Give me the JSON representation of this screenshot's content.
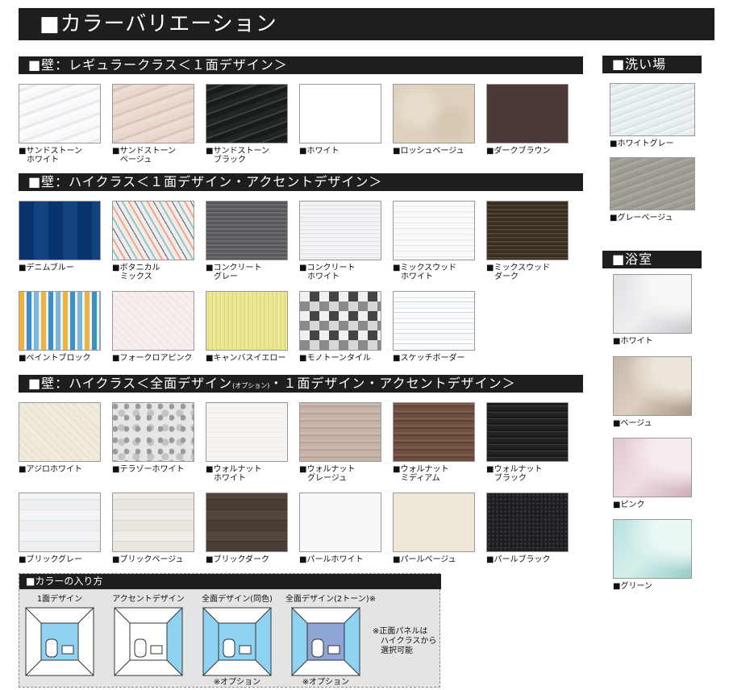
{
  "title": "■カラーバリエーション",
  "wall_regular": {
    "heading": "■壁：レギュラークラス＜１面デザイン＞",
    "items": [
      {
        "l1": "■サンドストーン",
        "l2": "ホワイト"
      },
      {
        "l1": "■サンドストーン",
        "l2": "ベージュ"
      },
      {
        "l1": "■サンドストーン",
        "l2": "ブラック"
      },
      {
        "l1": "■ホワイト",
        "l2": ""
      },
      {
        "l1": "■ロッシュベージュ",
        "l2": ""
      },
      {
        "l1": "■ダークブラウン",
        "l2": ""
      }
    ]
  },
  "wall_high1": {
    "heading": "■壁：ハイクラス＜１面デザイン・アクセントデザイン＞",
    "items": [
      {
        "l1": "■デニムブルー",
        "l2": ""
      },
      {
        "l1": "■ボタニカル",
        "l2": "ミックス"
      },
      {
        "l1": "■コンクリート",
        "l2": "グレー"
      },
      {
        "l1": "■コンクリート",
        "l2": "ホワイト"
      },
      {
        "l1": "■ミックスウッド",
        "l2": "ホワイト"
      },
      {
        "l1": "■ミックスウッド",
        "l2": "ダーク"
      },
      {
        "l1": "■ペイントブロック",
        "l2": ""
      },
      {
        "l1": "■フォークロアピンク",
        "l2": ""
      },
      {
        "l1": "■キャンバスイエロー",
        "l2": ""
      },
      {
        "l1": "■モノトーンタイル",
        "l2": ""
      },
      {
        "l1": "■スケッチボーダー",
        "l2": ""
      }
    ]
  },
  "wall_high2": {
    "heading_a": "■壁：ハイクラス＜全面デザイン",
    "heading_opt": "(オプション)",
    "heading_b": "・１面デザイン・アクセントデザイン＞",
    "items": [
      {
        "l1": "■アジロホワイト",
        "l2": ""
      },
      {
        "l1": "■テラゾーホワイト",
        "l2": ""
      },
      {
        "l1": "■ウォルナット",
        "l2": "ホワイト"
      },
      {
        "l1": "■ウォルナット",
        "l2": "グレージュ"
      },
      {
        "l1": "■ウォルナット",
        "l2": "ミディアム"
      },
      {
        "l1": "■ウォルナット",
        "l2": "ブラック"
      },
      {
        "l1": "■ブリックグレー",
        "l2": ""
      },
      {
        "l1": "■ブリックベージュ",
        "l2": ""
      },
      {
        "l1": "■ブリックダーク",
        "l2": ""
      },
      {
        "l1": "■パールホワイト",
        "l2": ""
      },
      {
        "l1": "■パールベージュ",
        "l2": ""
      },
      {
        "l1": "■パールブラック",
        "l2": ""
      }
    ]
  },
  "washing_area": {
    "heading": "■洗い場",
    "items": [
      {
        "l1": "■ホワイトグレー"
      },
      {
        "l1": "■グレーベージュ"
      }
    ]
  },
  "bathtub": {
    "heading": "■浴室",
    "items": [
      {
        "l1": "■ホワイト"
      },
      {
        "l1": "■ベージュ"
      },
      {
        "l1": "■ピンク"
      },
      {
        "l1": "■グリーン"
      }
    ]
  },
  "how_to": {
    "heading": "■カラーの入り方",
    "items": [
      {
        "caption": "1面デザイン",
        "option": ""
      },
      {
        "caption": "アクセントデザイン",
        "option": ""
      },
      {
        "caption": "全面デザイン(同色)",
        "option": "※オプション"
      },
      {
        "caption": "全面デザイン(2トーン)※",
        "option": "※オプション"
      }
    ],
    "note": [
      "※正面パネルは",
      "ハイクラスから",
      "選択可能"
    ]
  },
  "colors": {
    "header_bg": "#1e1e1e",
    "accent_blue": "#8fd3f3",
    "accent_blue_dark": "#8ea5d6"
  }
}
